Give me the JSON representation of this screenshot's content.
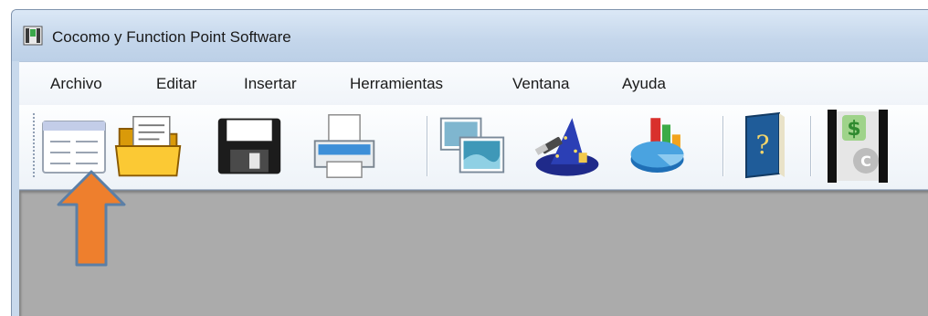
{
  "window": {
    "title": "Cocomo y Function Point Software"
  },
  "menu": [
    "Archivo",
    "Editar",
    "Insertar",
    "Herramientas",
    "Ventana",
    "Ayuda"
  ],
  "toolbar_icons": [
    "new-document-icon",
    "open-folder-icon",
    "save-icon",
    "print-icon",
    "windows-icon",
    "wizard-icon",
    "chart-icon",
    "help-book-icon",
    "cost-icon"
  ],
  "colors": {
    "arrow": "#ee7f2d",
    "arrow_outline": "#5b7fa6",
    "workspace": "#ababab"
  }
}
